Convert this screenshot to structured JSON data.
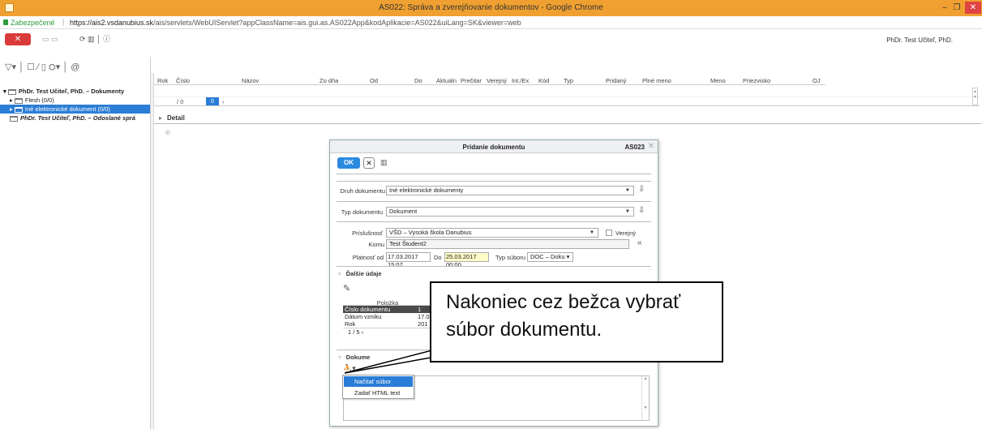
{
  "window": {
    "title": "AS022: Správa a zverejňovanie dokumentov - Google Chrome",
    "min": "–",
    "max": "❐",
    "close": "✕"
  },
  "address": {
    "security": "Zabezpečené",
    "host": "https://ais2.vsdanubius.sk",
    "path": "/ais/servlets/WebUIServlet?appClassName=ais.gui.as.AS022App&kodAplikacie=AS022&uiLang=SK&viewer=web"
  },
  "toolbar": {
    "close_label": "✕",
    "disabled_1": "▭ ▭",
    "icons": "⟳ ▥ │ ⓘ"
  },
  "user": "PhDr. Test Učiteľ, PhD.",
  "left_tools": "▽▾ │ ☐ ∕ ▯ ⛭▾ │ @",
  "tree": [
    {
      "label": "PhDr. Test Učiteľ, PhD. – Dokumenty",
      "arrow": "▾"
    },
    {
      "label": "Flesh (0/0)",
      "arrow": "▸"
    },
    {
      "label": "Iné elektronické dokument (0/0)",
      "arrow": "▸"
    },
    {
      "label": "PhDr. Test Učiteľ, PhD. – Odoslané sprá",
      "arrow": ""
    }
  ],
  "grid": {
    "columns": [
      "Rok",
      "Číslo",
      "Názov",
      "Zo dňa",
      "Od",
      "Do",
      "Aktuáln",
      "Prečitar",
      "Verejný",
      "Int./Ex",
      "Kód",
      "Typ",
      "Pridaný",
      "Plné meno",
      "Meno",
      "Priezvisko",
      "OJ"
    ],
    "pager_left": "/ 0",
    "pager_page": "0",
    "pager_right": "‹"
  },
  "detail": {
    "label": "Detail",
    "arrow": "▸",
    "zoom": "⊕"
  },
  "dialog": {
    "title": "Pridanie dokumentu",
    "code": "AS023",
    "close": "✕",
    "ok": "OK",
    "cancel": "✕",
    "icon": "▥",
    "druh_label": "Druh dokumentu",
    "druh_value": "Iné elektronické dokumenty",
    "typ_label": "Typ dokumentu",
    "typ_value": "Dokument",
    "prisl_label": "Príslušnosť",
    "prisl_value": "VŠD – Vysoká škola Danubius",
    "verejny_label": "Verejný",
    "komu_label": "Komu",
    "komu_value": "Test Študent2",
    "platnost_label": "Platnosť od",
    "platnost_od": "17.03.2017 15:07",
    "do_label": "Do",
    "platnost_do": "25.03.2017 00:00",
    "typ_suboru_label": "Typ súboru",
    "typ_suboru_value": "DOC – Doku ▾",
    "dalsie_label": "Ďalšie údaje",
    "subgrid": {
      "header": "Položka",
      "rows": [
        {
          "k": "Číslo dokumentu",
          "v": "1"
        },
        {
          "k": "Dátum vzniku",
          "v": "17.03"
        },
        {
          "k": "Rok",
          "v": "201"
        }
      ],
      "pager": "1  /  5  ‹"
    },
    "dokument_label": "Dokume",
    "runner": "⛹▾"
  },
  "menu": {
    "items": [
      "Načítať súbor",
      "Zadať HTML text"
    ]
  },
  "callout": {
    "text": "Nakoniec cez bežca vybrať súbor dokumentu."
  }
}
